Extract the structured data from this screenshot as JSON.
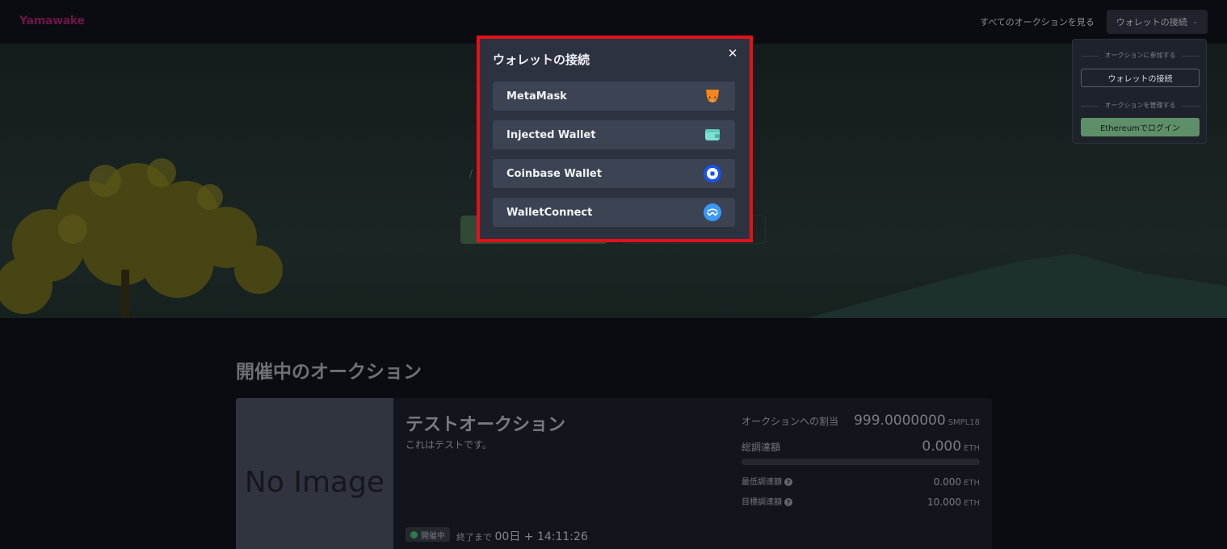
{
  "header": {
    "logo": "Yamawake",
    "all_auctions_link": "すべてのオークションを見る",
    "wallet_button": "ウォレットの接続",
    "chevron_icon": "chevron-down-icon"
  },
  "dropdown": {
    "join_group_label": "オークションに参加する",
    "connect_wallet": "ウォレットの接続",
    "manage_group_label": "オークションを管理する",
    "ethereum_login": "Ethereumでログイン"
  },
  "modal": {
    "title": "ウォレットの接続",
    "close_icon": "close-icon",
    "options": [
      {
        "label": "MetaMask",
        "icon": "metamask-fox-icon"
      },
      {
        "label": "Injected Wallet",
        "icon": "wallet-icon"
      },
      {
        "label": "Coinbase Wallet",
        "icon": "coinbase-icon"
      },
      {
        "label": "WalletConnect",
        "icon": "walletconnect-icon"
      }
    ]
  },
  "hero": {
    "slash": "/"
  },
  "section": {
    "title": "開催中のオークション"
  },
  "auction": {
    "no_image": "No Image",
    "title": "テストオークション",
    "description": "これはテストです。",
    "status": "開催中",
    "countdown_prefix": "終了まで",
    "countdown_value": "00日 + 14:11:26",
    "allocation_label": "オークションへの割当",
    "allocation_value": "999.0000000",
    "allocation_unit": "SMPL18",
    "total_raised_label": "総調達額",
    "total_raised_value": "0.000",
    "total_raised_unit": "ETH",
    "raised_fraction": 0,
    "min_raise_label": "最低調達額",
    "min_raise_value": "0.000",
    "min_raise_unit": "ETH",
    "target_raise_label": "目標調達額",
    "target_raise_value": "10.000",
    "target_raise_unit": "ETH",
    "help_glyph": "?"
  },
  "colors": {
    "accent_green": "#5f8f68",
    "logo": "#a5226e",
    "highlight": "#e5101a",
    "status_dot": "#48bb78"
  }
}
